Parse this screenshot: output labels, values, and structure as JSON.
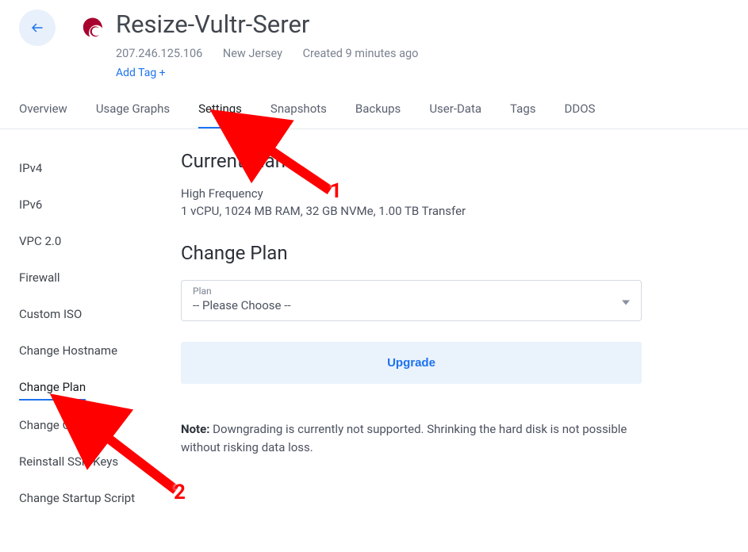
{
  "header": {
    "title": "Resize-Vultr-Serer",
    "ip": "207.246.125.106",
    "location": "New Jersey",
    "created": "Created 9 minutes ago",
    "add_tag": "Add Tag +"
  },
  "tabs": [
    {
      "label": "Overview"
    },
    {
      "label": "Usage Graphs"
    },
    {
      "label": "Settings"
    },
    {
      "label": "Snapshots"
    },
    {
      "label": "Backups"
    },
    {
      "label": "User-Data"
    },
    {
      "label": "Tags"
    },
    {
      "label": "DDOS"
    }
  ],
  "active_tab": "Settings",
  "sidebar": {
    "items": [
      {
        "label": "IPv4"
      },
      {
        "label": "IPv6"
      },
      {
        "label": "VPC 2.0"
      },
      {
        "label": "Firewall"
      },
      {
        "label": "Custom ISO"
      },
      {
        "label": "Change Hostname"
      },
      {
        "label": "Change Plan"
      },
      {
        "label": "Change OS"
      },
      {
        "label": "Reinstall SSH Keys"
      },
      {
        "label": "Change Startup Script"
      }
    ],
    "active": "Change Plan"
  },
  "main": {
    "current_plan_heading": "Current Plan",
    "plan_type": "High Frequency",
    "plan_specs": "1 vCPU, 1024 MB RAM, 32 GB NVMe, 1.00 TB Transfer",
    "change_plan_heading": "Change Plan",
    "select_label": "Plan",
    "select_value": "-- Please Choose --",
    "upgrade_label": "Upgrade",
    "note_label": "Note:",
    "note_text": " Downgrading is currently not supported. Shrinking the hard disk is not possible without risking data loss."
  },
  "annotations": {
    "num1": "1",
    "num2": "2"
  }
}
